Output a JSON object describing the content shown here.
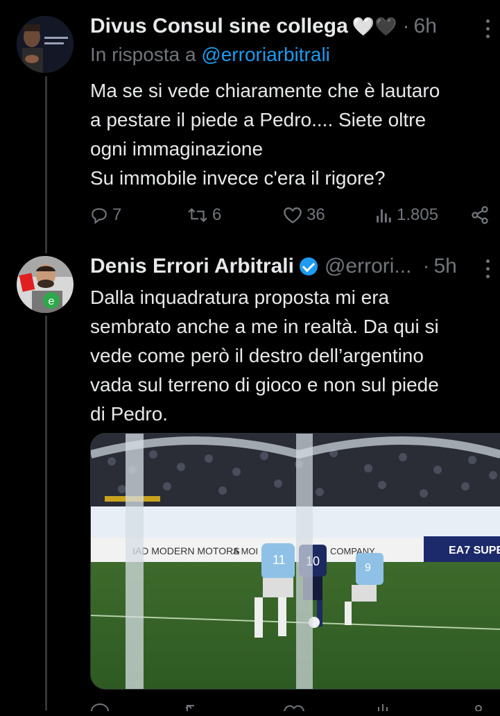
{
  "tweets": [
    {
      "author_name": "Divus Consul sine collega",
      "emoji": "🤍🖤",
      "time": "6h",
      "reply_prefix": "In risposta a ",
      "reply_handle": "@erroriarbitrali",
      "avatar_text": "Nulla ogni tanto. E' too suino!",
      "text": "Ma  se si vede chiaramente che è lautaro\na pestare il piede a Pedro.... Siete oltre\nogni immaginazione\nSu immobile invece c'era il rigore?",
      "stats": {
        "replies": "7",
        "reposts": "6",
        "likes": "36",
        "views": "1.805"
      }
    },
    {
      "author_name": "Denis Errori Arbitrali",
      "handle": "@errori...",
      "time": "5h",
      "text": "Dalla inquadratura proposta mi era\nsembrato anche a me in realtà. Da qui si\nvede come però il destro dell’argentino\nvada sul terreno di gioco e non sul piede\ndi Pedro.",
      "media": {
        "board_left": "IAD MODERN MOTORS",
        "board_mid": "A MOI",
        "board_company": "COMPANY",
        "board_right": "EA7 SUPER",
        "player_numbers": [
          "11",
          "10",
          "9"
        ]
      }
    }
  ],
  "colors": {
    "accent": "#1d9bf0",
    "muted": "#71767b",
    "background": "#000000"
  }
}
